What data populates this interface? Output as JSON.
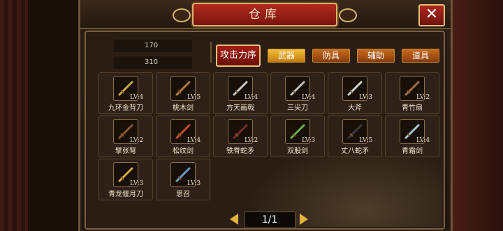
{
  "header": {
    "title": "仓库",
    "close_label": "✕"
  },
  "currency": {
    "coins": "170",
    "ingots": "310"
  },
  "action": {
    "attack_order_label": "攻击力序"
  },
  "tabs": [
    {
      "label": "武器",
      "active": true
    },
    {
      "label": "防具",
      "active": false
    },
    {
      "label": "辅助",
      "active": false
    },
    {
      "label": "道具",
      "active": false
    }
  ],
  "items": [
    {
      "name": "九环金背刀",
      "level": "LV:4",
      "icon": "broadsword-icon"
    },
    {
      "name": "桃木剑",
      "level": "LV:5",
      "icon": "wooden-sword-icon"
    },
    {
      "name": "方天画戟",
      "level": "LV:4",
      "icon": "halberd-icon"
    },
    {
      "name": "三尖刀",
      "level": "LV:4",
      "icon": "trident-blade-icon"
    },
    {
      "name": "大斧",
      "level": "LV:3",
      "icon": "axe-icon"
    },
    {
      "name": "青竹扇",
      "level": "LV:2",
      "icon": "fan-icon"
    },
    {
      "name": "擘张弩",
      "level": "LV:2",
      "icon": "crossbow-icon"
    },
    {
      "name": "松纹剑",
      "level": "LV:4",
      "icon": "sword-icon"
    },
    {
      "name": "铁脊蛇矛",
      "level": "LV:2",
      "icon": "snake-spear-icon"
    },
    {
      "name": "双股剑",
      "level": "LV:3",
      "icon": "twin-swords-icon"
    },
    {
      "name": "丈八蛇矛",
      "level": "LV:5",
      "icon": "long-spear-icon"
    },
    {
      "name": "青霜剑",
      "level": "LV:4",
      "icon": "frost-sword-icon"
    },
    {
      "name": "青龙偃月刀",
      "level": "LV:3",
      "icon": "glaive-icon"
    },
    {
      "name": "思召",
      "level": "LV:3",
      "icon": "spear-icon"
    }
  ],
  "pager": {
    "label": "1/1"
  },
  "colors": {
    "accent_red": "#a31e14",
    "tab_active": "#f4c03a",
    "tab_inactive": "#c76a1c",
    "gold_trim": "#d9b36a"
  }
}
